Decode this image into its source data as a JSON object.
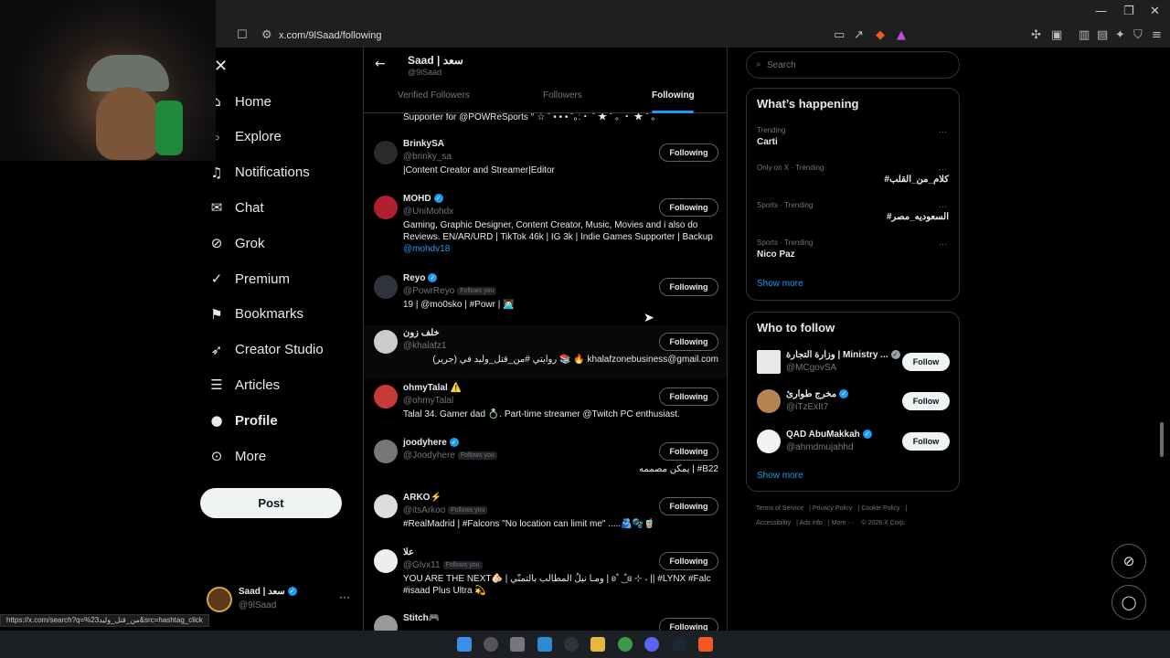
{
  "browser": {
    "url": "x.com/9lSaad/following",
    "status_url": "https://x.com/search?q=%23من_قتل_وليد&src=hashtag_click"
  },
  "nav": {
    "items": [
      {
        "label": "Home",
        "icon": "home-icon"
      },
      {
        "label": "Explore",
        "icon": "search-icon"
      },
      {
        "label": "Notifications",
        "icon": "bell-icon"
      },
      {
        "label": "Chat",
        "icon": "mail-icon"
      },
      {
        "label": "Grok",
        "icon": "grok-icon"
      },
      {
        "label": "Premium",
        "icon": "x-logo-icon"
      },
      {
        "label": "Bookmarks",
        "icon": "bookmark-icon"
      },
      {
        "label": "Creator Studio",
        "icon": "rocket-icon"
      },
      {
        "label": "Articles",
        "icon": "article-icon"
      },
      {
        "label": "Profile",
        "icon": "person-icon"
      },
      {
        "label": "More",
        "icon": "more-circle-icon"
      }
    ],
    "post_label": "Post"
  },
  "account": {
    "name": "Saad | سعد",
    "handle": "@9lSaad",
    "more": "···"
  },
  "header": {
    "title": "Saad | سعد",
    "subtitle": "@9lSaad",
    "tabs": [
      "Verified Followers",
      "Followers",
      "Following"
    ]
  },
  "following": {
    "partial_top": "Supporter for @POWReSports ° ☆ ˚ • • • ˚｡:・ ˚ ★ ˚ ｡ ・ ★ ˚ ｡",
    "follows_you": "Follows you",
    "button_label": "Following",
    "rows": [
      {
        "name": "BrinkySA",
        "handle": "@brinky_sa",
        "verified": false,
        "follows_you": false,
        "bio": "|Content Creator and Streamer|Editor"
      },
      {
        "name": "MOHD",
        "handle": "@UniMohdx",
        "verified": true,
        "follows_you": false,
        "bio": "Gaming, Graphic Designer, Content Creator, Music, Movies and i also do Reviews. EN/AR/URD | TikTok 46k | IG 3k | Indie Games Supporter | Backup",
        "bio_link": "@mohdv18"
      },
      {
        "name": "Reyo",
        "handle": "@PowrReyo",
        "verified": true,
        "follows_you": true,
        "bio": "19 | @mo0sko | #Powr | 👨🏻‍💻"
      },
      {
        "name": "خلف زون",
        "handle": "@khalafz1",
        "verified": false,
        "follows_you": false,
        "bio": "روايتي #من_قتل_وليد في (جرير) 📚 🔥 khalafzonebusiness@gmail.com"
      },
      {
        "name": "ohmyTalal ⚠️",
        "handle": "@ohmyTalal",
        "verified": false,
        "follows_you": false,
        "bio": "Talal 34. Gamer dad 💍. Part-time streamer @Twitch PC enthusiast."
      },
      {
        "name": "joodyhere",
        "handle": "@Joodyhere",
        "verified": true,
        "follows_you": true,
        "bio": "يمكن مصممه | #B22"
      },
      {
        "name": "ARKO⚡",
        "handle": "@itsArkoo",
        "verified": false,
        "follows_you": true,
        "bio": "#RealMadrid | #Falcons \"No location can limit me\" .....🫂🫧🧋"
      },
      {
        "name": "علا",
        "handle": "@Glvx11",
        "verified": false,
        "follows_you": true,
        "bio": "YOU ARE THE NEXT🫵🏻 | ومـا نيلُ المطالب بالتمنّي | ʚ˚ ͜ ˚ɞ ⊹ ˖ || #LYNX #Falc #isaad Plus Ultra 💫"
      },
      {
        "name": "Stitch🎮",
        "handle": "",
        "verified": false,
        "follows_you": false,
        "bio": ""
      }
    ]
  },
  "sidebar": {
    "search_placeholder": "Search",
    "trending_title": "What’s happening",
    "trends": [
      {
        "context": "Trending",
        "name": "Carti"
      },
      {
        "context": "Only on X · Trending",
        "name": "#كلام_من_القلب"
      },
      {
        "context": "Sports · Trending",
        "name": "#السعوديه_مصر"
      },
      {
        "context": "Sports · Trending",
        "name": "Nico Paz"
      }
    ],
    "show_more": "Show more",
    "who_to_follow_title": "Who to follow",
    "follow_label": "Follow",
    "suggestions": [
      {
        "name": "وزارة التجارة | Ministry ...",
        "handle": "@MCgovSA",
        "badge": "gray"
      },
      {
        "name": "مخرج طوارئ",
        "handle": "@iTzExIt7",
        "badge": "blue"
      },
      {
        "name": "QAD AbuMakkah",
        "handle": "@ahmdmujahhd",
        "badge": "blue"
      }
    ],
    "footer": [
      "Terms of Service",
      "Privacy Policy",
      "Cookie Policy",
      "Accessibility",
      "Ads info",
      "More ···",
      "© 2026 X Corp."
    ]
  },
  "colors": {
    "accent": "#1d9bf0",
    "background": "#000000",
    "border": "#2f3336",
    "muted": "#71767b"
  }
}
